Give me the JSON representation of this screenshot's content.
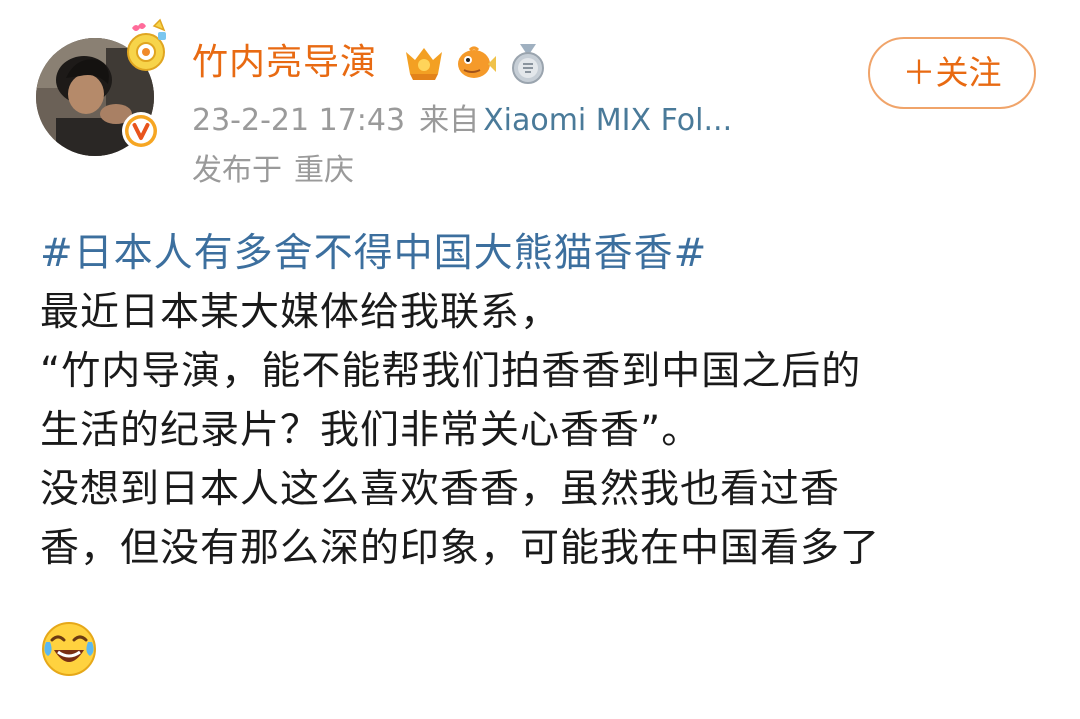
{
  "post": {
    "author": {
      "name": "竹内亮导演",
      "badges": [
        "sun-badge-icon",
        "fish-badge-icon",
        "medal-badge-icon"
      ],
      "verified": "verified-v-icon"
    },
    "meta": {
      "time": "23-2-21 17:43",
      "source_prefix": "来自",
      "source": "Xiaomi MIX Fol...",
      "location_prefix": "发布于",
      "location": "重庆"
    },
    "follow_button": "＋关注",
    "content": {
      "topic": "#日本人有多舍不得中国大熊猫香香#",
      "lines": [
        "最近日本某大媒体给我联系，",
        "“竹内导演，能不能帮我们拍香香到中国之后的",
        "生活的纪录片？我们非常关心香香”。",
        "没想到日本人这么喜欢香香，虽然我也看过香",
        "香，但没有那么深的印象，可能我在中国看多了"
      ],
      "emoji": "laugh-cry-emoji-icon"
    }
  },
  "colors": {
    "accent": "#e86a12",
    "topic": "#3c6f9e",
    "meta": "#9a9a9a",
    "source": "#4a7a99",
    "follow_border": "#f0a46a"
  }
}
